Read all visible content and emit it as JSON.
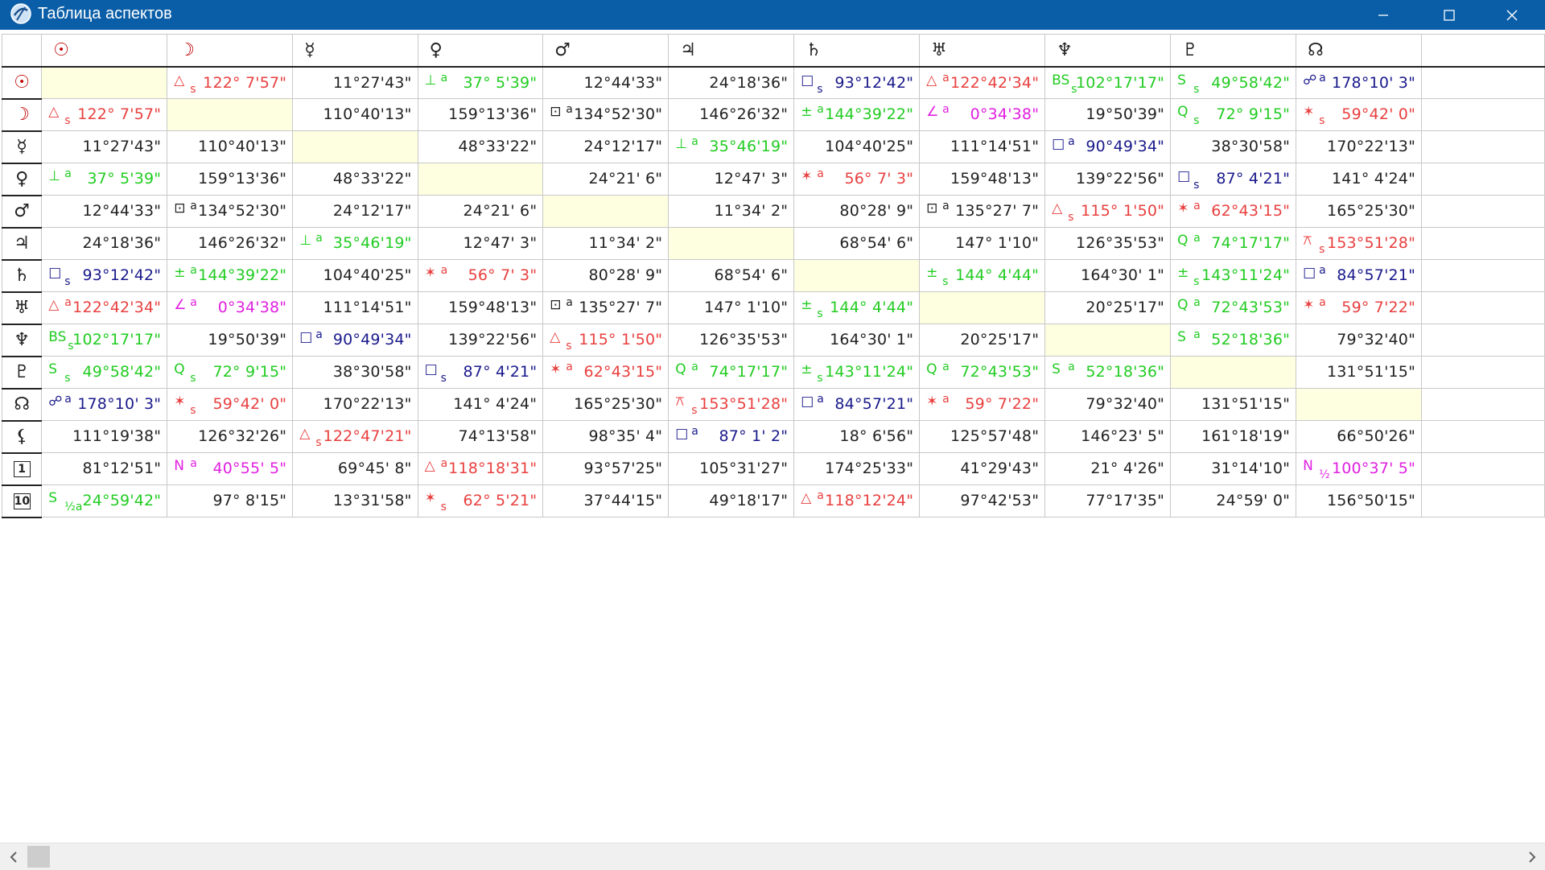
{
  "window": {
    "title": "Таблица аспектов"
  },
  "colors": {
    "titlebar": "#0a5ea8",
    "black": "#222222",
    "red": "#e8403f",
    "green": "#22cc22",
    "blue": "#1a1a8c",
    "magenta": "#e020e0",
    "diagonal": "#fefee0"
  },
  "columns": [
    {
      "glyph": "☉",
      "name": "sun-icon"
    },
    {
      "glyph": "☽",
      "name": "moon-icon"
    },
    {
      "glyph": "☿",
      "name": "mercury-icon"
    },
    {
      "glyph": "♀",
      "name": "venus-icon"
    },
    {
      "glyph": "♂",
      "name": "mars-icon"
    },
    {
      "glyph": "♃",
      "name": "jupiter-icon"
    },
    {
      "glyph": "♄",
      "name": "saturn-icon"
    },
    {
      "glyph": "♅",
      "name": "uranus-icon"
    },
    {
      "glyph": "♆",
      "name": "neptune-icon"
    },
    {
      "glyph": "♇",
      "name": "pluto-icon"
    },
    {
      "glyph": "☊",
      "name": "node-icon"
    }
  ],
  "rows": [
    {
      "glyph": "☉",
      "name": "sun-icon",
      "box": false,
      "cells": [
        null,
        {
          "a": "△",
          "s": "s",
          "v": "122° 7'57\"",
          "c": "red"
        },
        {
          "v": "11°27'43\"",
          "c": "black"
        },
        {
          "a": "⊥",
          "s": "a",
          "v": "37° 5'39\"",
          "c": "green"
        },
        {
          "v": "12°44'33\"",
          "c": "black"
        },
        {
          "v": "24°18'36\"",
          "c": "black"
        },
        {
          "a": "□",
          "s": "s",
          "v": "93°12'42\"",
          "c": "blue"
        },
        {
          "a": "△",
          "s": "a",
          "v": "122°42'34\"",
          "c": "red"
        },
        {
          "a": "BS",
          "s": "s",
          "v": "102°17'17\"",
          "c": "green"
        },
        {
          "a": "S",
          "s": "s",
          "v": "49°58'42\"",
          "c": "green"
        },
        {
          "a": "☍",
          "s": "a",
          "v": "178°10' 3\"",
          "c": "blue"
        }
      ]
    },
    {
      "glyph": "☽",
      "name": "moon-icon",
      "box": false,
      "cells": [
        {
          "a": "△",
          "s": "s",
          "v": "122° 7'57\"",
          "c": "red"
        },
        null,
        {
          "v": "110°40'13\"",
          "c": "black"
        },
        {
          "v": "159°13'36\"",
          "c": "black"
        },
        {
          "a": "⊡",
          "s": "a",
          "v": "134°52'30\"",
          "c": "black"
        },
        {
          "v": "146°26'32\"",
          "c": "black"
        },
        {
          "a": "±",
          "s": "a",
          "v": "144°39'22\"",
          "c": "green"
        },
        {
          "a": "∠",
          "s": "a",
          "v": "0°34'38\"",
          "c": "magenta"
        },
        {
          "v": "19°50'39\"",
          "c": "black"
        },
        {
          "a": "Q",
          "s": "s",
          "v": "72° 9'15\"",
          "c": "green"
        },
        {
          "a": "✶",
          "s": "s",
          "v": "59°42' 0\"",
          "c": "red"
        }
      ]
    },
    {
      "glyph": "☿",
      "name": "mercury-icon",
      "box": false,
      "cells": [
        {
          "v": "11°27'43\"",
          "c": "black"
        },
        {
          "v": "110°40'13\"",
          "c": "black"
        },
        null,
        {
          "v": "48°33'22\"",
          "c": "black"
        },
        {
          "v": "24°12'17\"",
          "c": "black"
        },
        {
          "a": "⊥",
          "s": "a",
          "v": "35°46'19\"",
          "c": "green"
        },
        {
          "v": "104°40'25\"",
          "c": "black"
        },
        {
          "v": "111°14'51\"",
          "c": "black"
        },
        {
          "a": "□",
          "s": "a",
          "v": "90°49'34\"",
          "c": "blue"
        },
        {
          "v": "38°30'58\"",
          "c": "black"
        },
        {
          "v": "170°22'13\"",
          "c": "black"
        }
      ]
    },
    {
      "glyph": "♀",
      "name": "venus-icon",
      "box": false,
      "cells": [
        {
          "a": "⊥",
          "s": "a",
          "v": "37° 5'39\"",
          "c": "green"
        },
        {
          "v": "159°13'36\"",
          "c": "black"
        },
        {
          "v": "48°33'22\"",
          "c": "black"
        },
        null,
        {
          "v": "24°21' 6\"",
          "c": "black"
        },
        {
          "v": "12°47' 3\"",
          "c": "black"
        },
        {
          "a": "✶",
          "s": "a",
          "v": "56° 7' 3\"",
          "c": "red"
        },
        {
          "v": "159°48'13\"",
          "c": "black"
        },
        {
          "v": "139°22'56\"",
          "c": "black"
        },
        {
          "a": "□",
          "s": "s",
          "v": "87° 4'21\"",
          "c": "blue"
        },
        {
          "v": "141° 4'24\"",
          "c": "black"
        }
      ]
    },
    {
      "glyph": "♂",
      "name": "mars-icon",
      "box": false,
      "cells": [
        {
          "v": "12°44'33\"",
          "c": "black"
        },
        {
          "a": "⊡",
          "s": "a",
          "v": "134°52'30\"",
          "c": "black"
        },
        {
          "v": "24°12'17\"",
          "c": "black"
        },
        {
          "v": "24°21' 6\"",
          "c": "black"
        },
        null,
        {
          "v": "11°34' 2\"",
          "c": "black"
        },
        {
          "v": "80°28' 9\"",
          "c": "black"
        },
        {
          "a": "⊡",
          "s": "a",
          "v": "135°27' 7\"",
          "c": "black"
        },
        {
          "a": "△",
          "s": "s",
          "v": "115° 1'50\"",
          "c": "red"
        },
        {
          "a": "✶",
          "s": "a",
          "v": "62°43'15\"",
          "c": "red"
        },
        {
          "v": "165°25'30\"",
          "c": "black"
        }
      ]
    },
    {
      "glyph": "♃",
      "name": "jupiter-icon",
      "box": false,
      "cells": [
        {
          "v": "24°18'36\"",
          "c": "black"
        },
        {
          "v": "146°26'32\"",
          "c": "black"
        },
        {
          "a": "⊥",
          "s": "a",
          "v": "35°46'19\"",
          "c": "green"
        },
        {
          "v": "12°47' 3\"",
          "c": "black"
        },
        {
          "v": "11°34' 2\"",
          "c": "black"
        },
        null,
        {
          "v": "68°54' 6\"",
          "c": "black"
        },
        {
          "v": "147° 1'10\"",
          "c": "black"
        },
        {
          "v": "126°35'53\"",
          "c": "black"
        },
        {
          "a": "Q",
          "s": "a",
          "v": "74°17'17\"",
          "c": "green"
        },
        {
          "a": "⚻",
          "s": "s",
          "v": "153°51'28\"",
          "c": "red"
        }
      ]
    },
    {
      "glyph": "♄",
      "name": "saturn-icon",
      "box": false,
      "cells": [
        {
          "a": "□",
          "s": "s",
          "v": "93°12'42\"",
          "c": "blue"
        },
        {
          "a": "±",
          "s": "a",
          "v": "144°39'22\"",
          "c": "green"
        },
        {
          "v": "104°40'25\"",
          "c": "black"
        },
        {
          "a": "✶",
          "s": "a",
          "v": "56° 7' 3\"",
          "c": "red"
        },
        {
          "v": "80°28' 9\"",
          "c": "black"
        },
        {
          "v": "68°54' 6\"",
          "c": "black"
        },
        null,
        {
          "a": "±",
          "s": "s",
          "v": "144° 4'44\"",
          "c": "green"
        },
        {
          "v": "164°30' 1\"",
          "c": "black"
        },
        {
          "a": "±",
          "s": "s",
          "v": "143°11'24\"",
          "c": "green"
        },
        {
          "a": "□",
          "s": "a",
          "v": "84°57'21\"",
          "c": "blue"
        }
      ]
    },
    {
      "glyph": "♅",
      "name": "uranus-icon",
      "box": false,
      "cells": [
        {
          "a": "△",
          "s": "a",
          "v": "122°42'34\"",
          "c": "red"
        },
        {
          "a": "∠",
          "s": "a",
          "v": "0°34'38\"",
          "c": "magenta"
        },
        {
          "v": "111°14'51\"",
          "c": "black"
        },
        {
          "v": "159°48'13\"",
          "c": "black"
        },
        {
          "a": "⊡",
          "s": "a",
          "v": "135°27' 7\"",
          "c": "black"
        },
        {
          "v": "147° 1'10\"",
          "c": "black"
        },
        {
          "a": "±",
          "s": "s",
          "v": "144° 4'44\"",
          "c": "green"
        },
        null,
        {
          "v": "20°25'17\"",
          "c": "black"
        },
        {
          "a": "Q",
          "s": "a",
          "v": "72°43'53\"",
          "c": "green"
        },
        {
          "a": "✶",
          "s": "a",
          "v": "59° 7'22\"",
          "c": "red"
        }
      ]
    },
    {
      "glyph": "♆",
      "name": "neptune-icon",
      "box": false,
      "cells": [
        {
          "a": "BS",
          "s": "s",
          "v": "102°17'17\"",
          "c": "green"
        },
        {
          "v": "19°50'39\"",
          "c": "black"
        },
        {
          "a": "□",
          "s": "a",
          "v": "90°49'34\"",
          "c": "blue"
        },
        {
          "v": "139°22'56\"",
          "c": "black"
        },
        {
          "a": "△",
          "s": "s",
          "v": "115° 1'50\"",
          "c": "red"
        },
        {
          "v": "126°35'53\"",
          "c": "black"
        },
        {
          "v": "164°30' 1\"",
          "c": "black"
        },
        {
          "v": "20°25'17\"",
          "c": "black"
        },
        null,
        {
          "a": "S",
          "s": "a",
          "v": "52°18'36\"",
          "c": "green"
        },
        {
          "v": "79°32'40\"",
          "c": "black"
        }
      ]
    },
    {
      "glyph": "♇",
      "name": "pluto-icon",
      "box": false,
      "cells": [
        {
          "a": "S",
          "s": "s",
          "v": "49°58'42\"",
          "c": "green"
        },
        {
          "a": "Q",
          "s": "s",
          "v": "72° 9'15\"",
          "c": "green"
        },
        {
          "v": "38°30'58\"",
          "c": "black"
        },
        {
          "a": "□",
          "s": "s",
          "v": "87° 4'21\"",
          "c": "blue"
        },
        {
          "a": "✶",
          "s": "a",
          "v": "62°43'15\"",
          "c": "red"
        },
        {
          "a": "Q",
          "s": "a",
          "v": "74°17'17\"",
          "c": "green"
        },
        {
          "a": "±",
          "s": "s",
          "v": "143°11'24\"",
          "c": "green"
        },
        {
          "a": "Q",
          "s": "a",
          "v": "72°43'53\"",
          "c": "green"
        },
        {
          "a": "S",
          "s": "a",
          "v": "52°18'36\"",
          "c": "green"
        },
        null,
        {
          "v": "131°51'15\"",
          "c": "black"
        }
      ]
    },
    {
      "glyph": "☊",
      "name": "node-icon",
      "box": false,
      "cells": [
        {
          "a": "☍",
          "s": "a",
          "v": "178°10' 3\"",
          "c": "blue"
        },
        {
          "a": "✶",
          "s": "s",
          "v": "59°42' 0\"",
          "c": "red"
        },
        {
          "v": "170°22'13\"",
          "c": "black"
        },
        {
          "v": "141° 4'24\"",
          "c": "black"
        },
        {
          "v": "165°25'30\"",
          "c": "black"
        },
        {
          "a": "⚻",
          "s": "s",
          "v": "153°51'28\"",
          "c": "red"
        },
        {
          "a": "□",
          "s": "a",
          "v": "84°57'21\"",
          "c": "blue"
        },
        {
          "a": "✶",
          "s": "a",
          "v": "59° 7'22\"",
          "c": "red"
        },
        {
          "v": "79°32'40\"",
          "c": "black"
        },
        {
          "v": "131°51'15\"",
          "c": "black"
        },
        null
      ]
    },
    {
      "glyph": "⚸",
      "name": "lilith-icon",
      "box": false,
      "cells": [
        {
          "v": "111°19'38\"",
          "c": "black"
        },
        {
          "v": "126°32'26\"",
          "c": "black"
        },
        {
          "a": "△",
          "s": "s",
          "v": "122°47'21\"",
          "c": "red"
        },
        {
          "v": "74°13'58\"",
          "c": "black"
        },
        {
          "v": "98°35' 4\"",
          "c": "black"
        },
        {
          "a": "□",
          "s": "a",
          "v": "87° 1' 2\"",
          "c": "blue"
        },
        {
          "v": "18° 6'56\"",
          "c": "black"
        },
        {
          "v": "125°57'48\"",
          "c": "black"
        },
        {
          "v": "146°23' 5\"",
          "c": "black"
        },
        {
          "v": "161°18'19\"",
          "c": "black"
        },
        {
          "v": "66°50'26\"",
          "c": "black"
        }
      ]
    },
    {
      "glyph": "1",
      "name": "house-1-icon",
      "box": true,
      "cells": [
        {
          "v": "81°12'51\"",
          "c": "black"
        },
        {
          "a": "N",
          "s": "a",
          "v": "40°55' 5\"",
          "c": "magenta"
        },
        {
          "v": "69°45' 8\"",
          "c": "black"
        },
        {
          "a": "△",
          "s": "a",
          "v": "118°18'31\"",
          "c": "red"
        },
        {
          "v": "93°57'25\"",
          "c": "black"
        },
        {
          "v": "105°31'27\"",
          "c": "black"
        },
        {
          "v": "174°25'33\"",
          "c": "black"
        },
        {
          "v": "41°29'43\"",
          "c": "black"
        },
        {
          "v": "21° 4'26\"",
          "c": "black"
        },
        {
          "v": "31°14'10\"",
          "c": "black"
        },
        {
          "a": "N",
          "s": "½",
          "v": "100°37' 5\"",
          "c": "magenta"
        }
      ]
    },
    {
      "glyph": "10",
      "name": "house-10-icon",
      "box": true,
      "cells": [
        {
          "a": "S",
          "s": "½a",
          "v": "24°59'42\"",
          "c": "green"
        },
        {
          "v": "97° 8'15\"",
          "c": "black"
        },
        {
          "v": "13°31'58\"",
          "c": "black"
        },
        {
          "a": "✶",
          "s": "s",
          "v": "62° 5'21\"",
          "c": "red"
        },
        {
          "v": "37°44'15\"",
          "c": "black"
        },
        {
          "v": "49°18'17\"",
          "c": "black"
        },
        {
          "a": "△",
          "s": "a",
          "v": "118°12'24\"",
          "c": "red"
        },
        {
          "v": "97°42'53\"",
          "c": "black"
        },
        {
          "v": "77°17'35\"",
          "c": "black"
        },
        {
          "v": "24°59' 0\"",
          "c": "black"
        },
        {
          "v": "156°50'15\"",
          "c": "black"
        }
      ]
    }
  ],
  "scrollbar": {
    "left_arrow": "‹",
    "right_arrow": "›"
  },
  "window_controls": {
    "minimize": "–",
    "maximize": "☐",
    "close": "✕"
  }
}
